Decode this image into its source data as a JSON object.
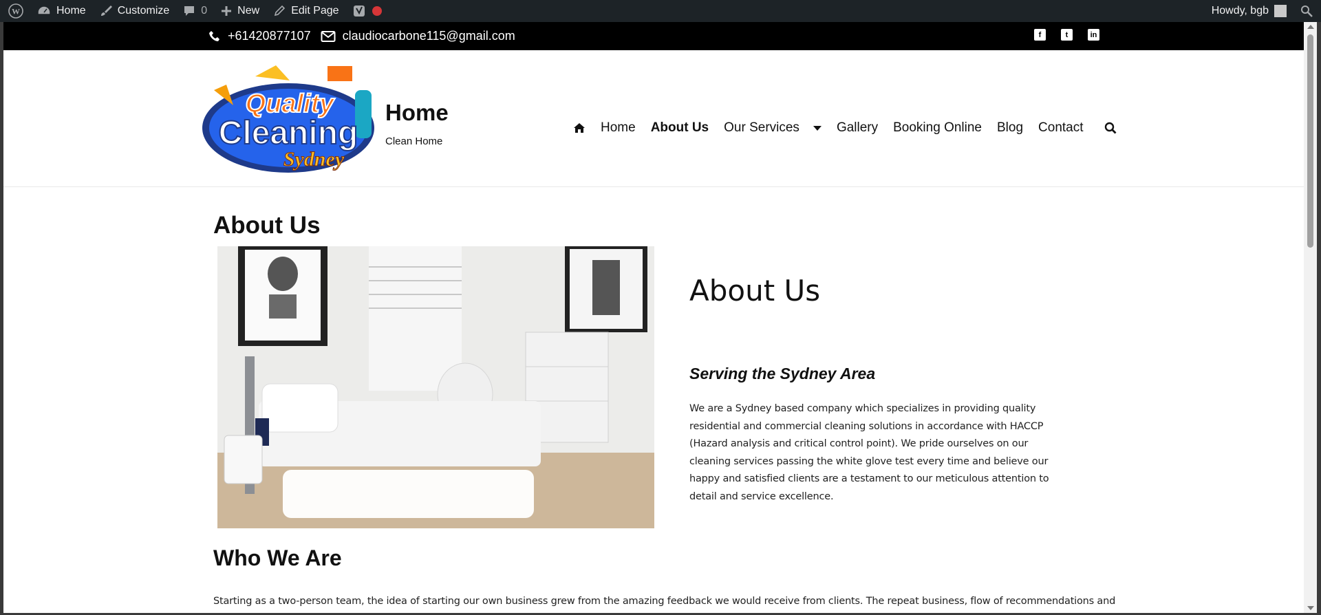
{
  "admin_bar": {
    "home": "Home",
    "customize": "Customize",
    "comments_count": "0",
    "new": "New",
    "edit_page": "Edit Page",
    "howdy": "Howdy, bgb"
  },
  "topbar": {
    "phone": "+61420877107",
    "email": "claudiocarbone115@gmail.com"
  },
  "header": {
    "site_title": "Home",
    "tagline": "Clean Home",
    "logo_text": [
      "Quality",
      "Cleaning",
      "Sydney"
    ]
  },
  "nav": {
    "items": [
      "Home",
      "About Us",
      "Our Services",
      "Gallery",
      "Booking Online",
      "Blog",
      "Contact"
    ],
    "active": "About Us"
  },
  "content": {
    "page_title": "About Us",
    "about_heading": "About Us",
    "serving_heading": "Serving the Sydney Area",
    "about_paragraph": "We are a Sydney based company which specializes in providing quality residential and commercial cleaning solutions in accordance with HACCP (Hazard analysis and critical control point). We pride ourselves on our cleaning services passing the white glove test every time and believe our happy and satisfied clients are a testament to our meticulous attention to detail and service excellence.",
    "who_heading": "Who We Are",
    "who_paragraph": "Starting as a two-person team, the idea of starting our own business grew from the amazing feedback we would receive from clients.  The repeat business, flow of recommendations and"
  },
  "colors": {
    "admin_bar_bg": "#1d2327",
    "topbar_bg": "#000000",
    "record_dot": "#d63638"
  }
}
